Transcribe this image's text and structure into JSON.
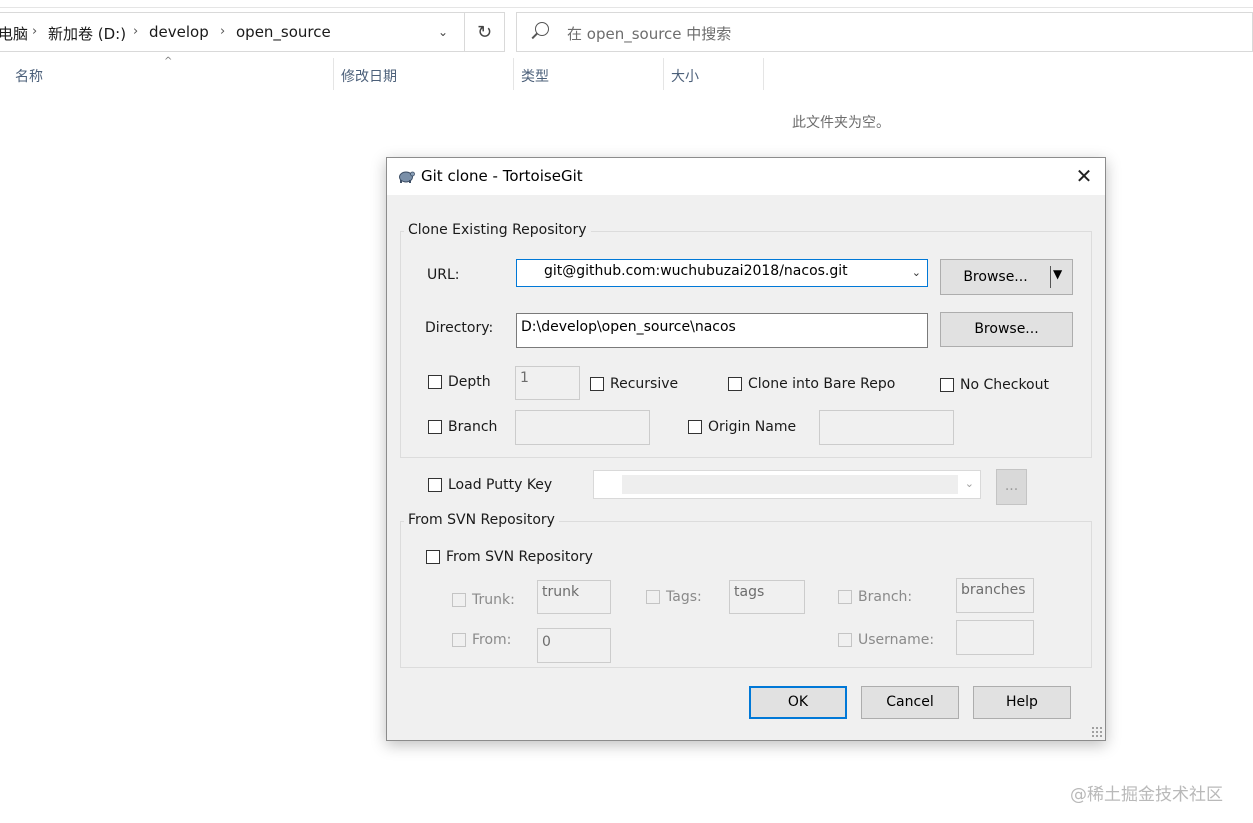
{
  "explorer": {
    "breadcrumbs": [
      "电脑",
      "新加卷 (D:)",
      "develop",
      "open_source"
    ],
    "search_placeholder": "在 open_source 中搜索",
    "columns": [
      "名称",
      "修改日期",
      "类型",
      "大小"
    ],
    "empty_message": "此文件夹为空。"
  },
  "dialog": {
    "title": "Git clone - TortoiseGit",
    "clone_group": {
      "label": "Clone Existing Repository",
      "url_label": "URL:",
      "url_value": "git@github.com:wuchubuzai2018/nacos.git",
      "url_browse": "Browse...",
      "directory_label": "Directory:",
      "directory_value": "D:\\develop\\open_source\\nacos",
      "directory_browse": "Browse...",
      "depth_label": "Depth",
      "depth_value": "1",
      "recursive_label": "Recursive",
      "bare_label": "Clone into Bare Repo",
      "no_checkout_label": "No Checkout",
      "branch_label": "Branch",
      "branch_value": "",
      "origin_label": "Origin Name",
      "origin_value": ""
    },
    "putty": {
      "label": "Load Putty Key",
      "browse": "..."
    },
    "svn_group": {
      "label": "From SVN Repository",
      "checkbox_label": "From SVN Repository",
      "trunk_label": "Trunk:",
      "trunk_value": "trunk",
      "tags_label": "Tags:",
      "tags_value": "tags",
      "branch_label": "Branch:",
      "branch_value": "branches",
      "from_label": "From:",
      "from_value": "0",
      "username_label": "Username:",
      "username_value": ""
    },
    "buttons": {
      "ok": "OK",
      "cancel": "Cancel",
      "help": "Help"
    }
  },
  "watermark": "@稀土掘金技术社区"
}
